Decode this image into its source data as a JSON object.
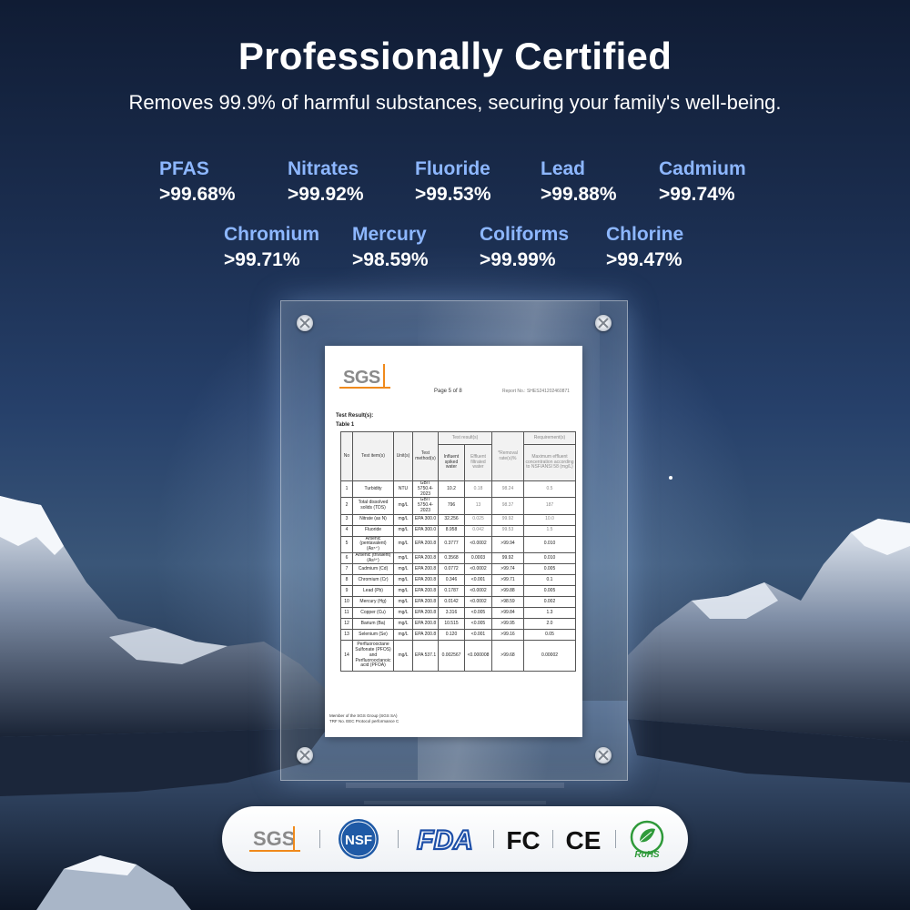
{
  "title": "Professionally Certified",
  "subtitle": "Removes 99.9% of harmful substances, securing your family's well-being.",
  "stats": [
    {
      "name": "PFAS",
      "value": ">99.68%"
    },
    {
      "name": "Nitrates",
      "value": ">99.92%"
    },
    {
      "name": "Fluoride",
      "value": ">99.53%"
    },
    {
      "name": "Lead",
      "value": ">99.88%"
    },
    {
      "name": "Cadmium",
      "value": ">99.74%"
    },
    {
      "name": "Chromium",
      "value": ">99.71%"
    },
    {
      "name": "Mercury",
      "value": ">98.59%"
    },
    {
      "name": "Coliforms",
      "value": ">99.99%"
    },
    {
      "name": "Chlorine",
      "value": ">99.47%"
    }
  ],
  "report": {
    "logo": "SGS",
    "page": "Page 5 of 8",
    "report_no": "Report No.: SHES241202460871",
    "section": "Test Result(s):",
    "table_title": "Table 1",
    "headers": {
      "no": "No",
      "item": "Test item(s)",
      "unit": "Unit(s)",
      "method": "Test method(s)",
      "results": "Test result(s)",
      "influent": "Influent spiked water",
      "effluent": "Effluent filtrated water",
      "removal": "*Removal rate(s)%",
      "requirement": "Requirement(s)",
      "max": "Maximum effluent concentration according to NSF/ANSI 58 (mg/L)"
    },
    "rows": [
      {
        "no": "1",
        "item": "Turbidity",
        "unit": "NTU",
        "method": "GB/T 5750.4-2023",
        "influent": "10.2",
        "effluent": "0.18",
        "removal": "98.24",
        "max": "0.5"
      },
      {
        "no": "2",
        "item": "Total dissolved solids (TDS)",
        "unit": "mg/L",
        "method": "GB/T 5750.4-2023",
        "influent": "796",
        "effluent": "13",
        "removal": "98.37",
        "max": "187"
      },
      {
        "no": "3",
        "item": "Nitrate (as N)",
        "unit": "mg/L",
        "method": "EPA 300.0",
        "influent": "32.256",
        "effluent": "0.025",
        "removal": "99.92",
        "max": "10.0"
      },
      {
        "no": "4",
        "item": "Fluoride",
        "unit": "mg/L",
        "method": "EPA 300.0",
        "influent": "8.958",
        "effluent": "0.042",
        "removal": "99.53",
        "max": "1.5"
      },
      {
        "no": "5",
        "item": "Arsenic (pentavalent) (As⁵⁺)",
        "unit": "mg/L",
        "method": "EPA 200.8",
        "influent": "0.3777",
        "effluent": "<0.0002",
        "removal": ">99.94",
        "max": "0.010"
      },
      {
        "no": "6",
        "item": "Arsenic (trivalent) (As³⁺)",
        "unit": "mg/L",
        "method": "EPA 200.8",
        "influent": "0.3568",
        "effluent": "0.0003",
        "removal": "99.92",
        "max": "0.010"
      },
      {
        "no": "7",
        "item": "Cadmium (Cd)",
        "unit": "mg/L",
        "method": "EPA 200.8",
        "influent": "0.0772",
        "effluent": "<0.0002",
        "removal": ">99.74",
        "max": "0.005"
      },
      {
        "no": "8",
        "item": "Chromium (Cr)",
        "unit": "mg/L",
        "method": "EPA 200.8",
        "influent": "0.346",
        "effluent": "<0.001",
        "removal": ">99.71",
        "max": "0.1"
      },
      {
        "no": "9",
        "item": "Lead (Pb)",
        "unit": "mg/L",
        "method": "EPA 200.8",
        "influent": "0.1787",
        "effluent": "<0.0002",
        "removal": ">99.88",
        "max": "0.005"
      },
      {
        "no": "10",
        "item": "Mercury (Hg)",
        "unit": "mg/L",
        "method": "EPA 200.8",
        "influent": "0.0142",
        "effluent": "<0.0002",
        "removal": ">98.59",
        "max": "0.002"
      },
      {
        "no": "11",
        "item": "Copper (Cu)",
        "unit": "mg/L",
        "method": "EPA 200.8",
        "influent": "3.316",
        "effluent": "<0.005",
        "removal": ">99.84",
        "max": "1.3"
      },
      {
        "no": "12",
        "item": "Barium (Ba)",
        "unit": "mg/L",
        "method": "EPA 200.8",
        "influent": "10.515",
        "effluent": "<0.005",
        "removal": ">99.95",
        "max": "2.0"
      },
      {
        "no": "13",
        "item": "Selenium (Se)",
        "unit": "mg/L",
        "method": "EPA 200.8",
        "influent": "0.120",
        "effluent": "<0.001",
        "removal": ">99.16",
        "max": "0.05"
      },
      {
        "no": "14",
        "item": "Perfluorooctane Sulfonate (PFOS) and Perfluorooctanoic acid (PFOA)",
        "unit": "mg/L",
        "method": "EPA 537.1",
        "influent": "0.002567",
        "effluent": "<0.000008",
        "removal": ">99.68",
        "max": "0.00002"
      }
    ],
    "footer_1": "Member of the SGS Group (SGS SA)",
    "footer_2": "TRF No. EEC   Protocol   performance C"
  },
  "certifications": [
    {
      "label": "SGS",
      "icon": "sgs-logo"
    },
    {
      "label": "NSF",
      "icon": "nsf-logo"
    },
    {
      "label": "FDA",
      "icon": "fda-logo"
    },
    {
      "label": "FC",
      "icon": "fc-logo"
    },
    {
      "label": "CE",
      "icon": "ce-logo"
    },
    {
      "label": "RoHS",
      "icon": "rohs-logo"
    }
  ],
  "colors": {
    "accent": "#8db7ff",
    "sgs_orange": "#f08a1c",
    "nsf_blue": "#1f5aa6",
    "fda_blue": "#1d4fa8",
    "rohs_green": "#2f9a3a"
  }
}
